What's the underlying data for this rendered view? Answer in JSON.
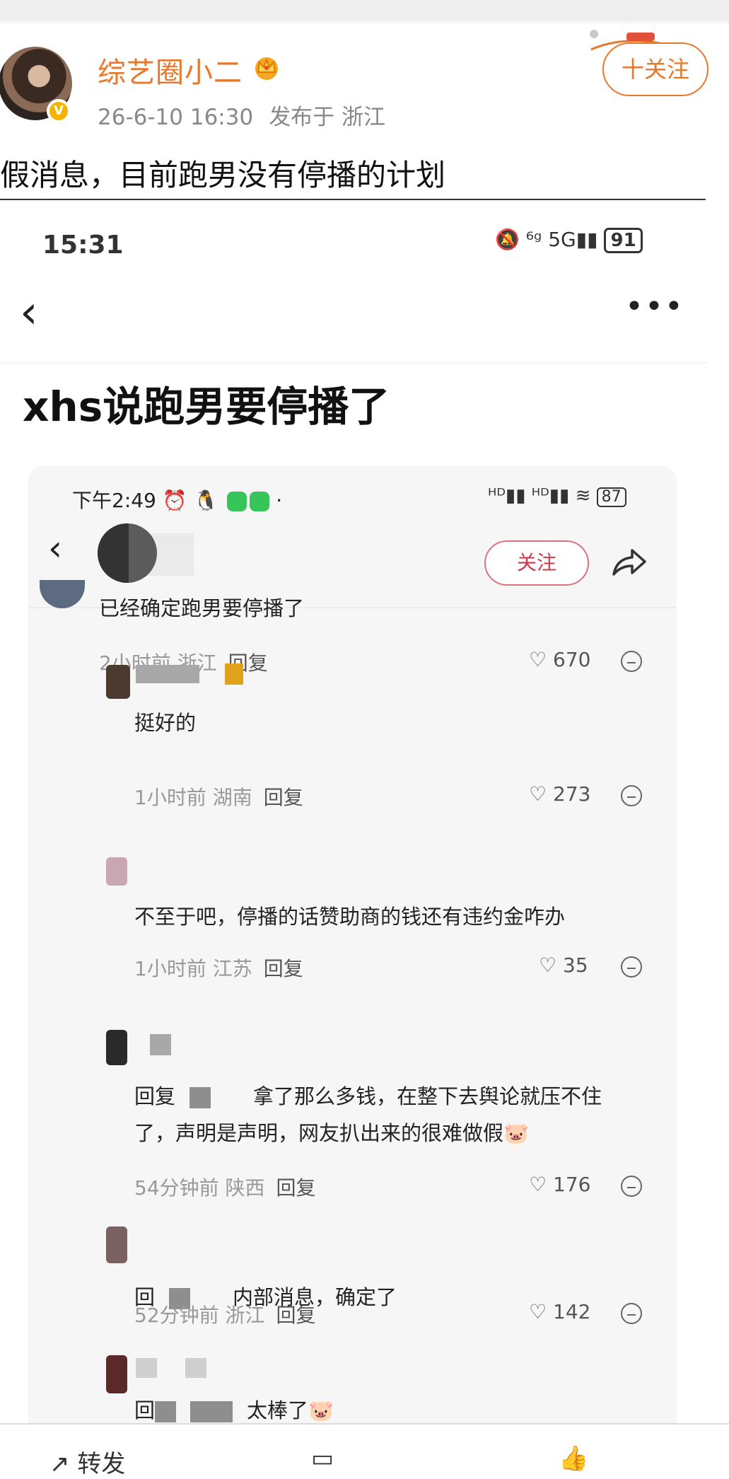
{
  "post": {
    "username": "综艺圈小二",
    "verified_badge": "V",
    "timestamp": "26-6-10 16:30",
    "location_label": "发布于 浙江",
    "follow_label": "十关注",
    "text": "假消息，目前跑男没有停播的计划"
  },
  "screenshot": {
    "status_time": "15:31",
    "status_icons": "🔕 ⁶ᵍ 5G▮▮",
    "battery": "91",
    "back_icon": "‹",
    "more_icon": "•••",
    "title": "xhs说跑男要停播了",
    "inner": {
      "status_time": "下午2:49",
      "status_extra": "⏰ 🐧",
      "status_right": "ᴴᴰ▮▮ ᴴᴰ▮▮ ≋",
      "battery": "87",
      "follow_label": "关注",
      "comments": [
        {
          "text": "已经确定跑男要停播了",
          "time_loc": "2小时前 浙江",
          "reply": "回复",
          "likes": "670"
        },
        {
          "text": "挺好的",
          "time_loc": "1小时前 湖南",
          "reply": "回复",
          "likes": "273"
        },
        {
          "text": "不至于吧，停播的话赞助商的钱还有违约金咋办",
          "time_loc": "1小时前 江苏",
          "reply": "回复",
          "likes": "35"
        },
        {
          "text_prefix": "回复",
          "text": "拿了那么多钱，在整下去舆论就压不住了，声明是声明，网友扒出来的很难做假🐷",
          "time_loc": "54分钟前 陕西",
          "reply": "回复",
          "likes": "176"
        },
        {
          "text_prefix": "回",
          "text": "内部消息，确定了",
          "time_loc": "52分钟前 浙江",
          "reply": "回复",
          "likes": "142"
        },
        {
          "text_prefix": "回",
          "text": "太棒了🐷"
        }
      ]
    }
  },
  "bottom_bar": {
    "repost": "转发",
    "comment": "",
    "like": ""
  }
}
